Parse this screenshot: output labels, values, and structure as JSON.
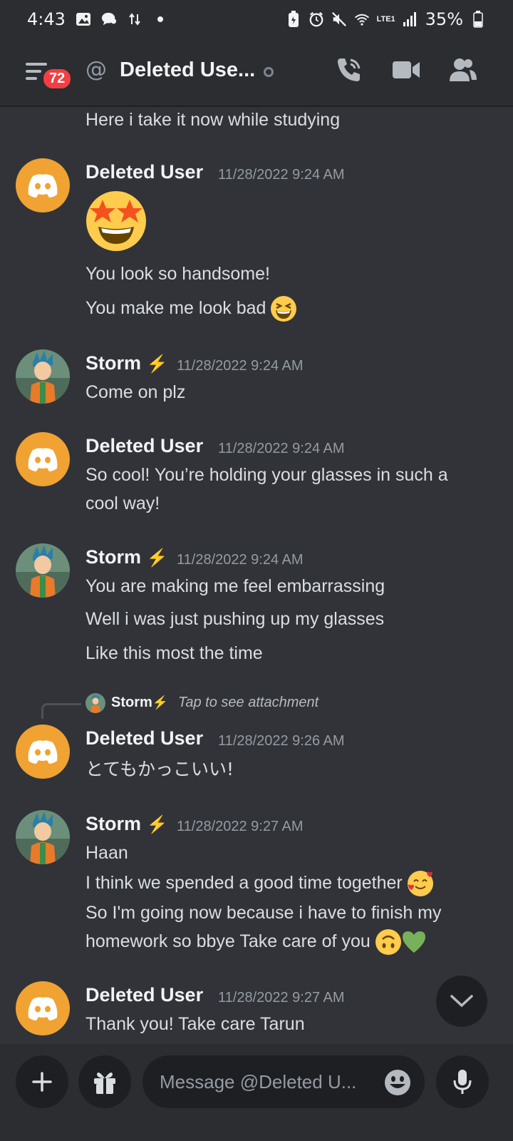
{
  "status_bar": {
    "time": "4:43",
    "battery": "35%",
    "lte": "LTE1"
  },
  "header": {
    "notification_count": "72",
    "title": "Deleted Use...",
    "at_symbol": "@"
  },
  "messages": {
    "first_line": "Here i take it now while studying",
    "m1": {
      "author": "Deleted User",
      "time": "11/28/2022 9:24 AM",
      "line1": "You look so handsome!",
      "line2": "You make me look bad"
    },
    "m2": {
      "author": "Storm",
      "time": "11/28/2022 9:24 AM",
      "line1": "Come on plz"
    },
    "m3": {
      "author": "Deleted User",
      "time": "11/28/2022 9:24 AM",
      "line1": "So cool! You’re holding your glasses in such a",
      "line2": "cool way!"
    },
    "m4": {
      "author": "Storm",
      "time": "11/28/2022 9:24 AM",
      "line1": "You are making me feel embarrassing",
      "line2": "Well i was just pushing up my glasses",
      "line3": "Like this most the time"
    },
    "reply": {
      "name": "Storm",
      "text": "Tap to see attachment"
    },
    "m5": {
      "author": "Deleted User",
      "time": "11/28/2022 9:26 AM",
      "line1": "とてもかっこいい!"
    },
    "m6": {
      "author": "Storm",
      "time": "11/28/2022 9:27 AM",
      "line1": "Haan",
      "line2": "I think we spended a good time together",
      "line3": "So I'm going now because i have to finish my",
      "line4": "homework so bbye Take care of you"
    },
    "m7": {
      "author": "Deleted User",
      "time": "11/28/2022 9:27 AM",
      "line1": "Thank you! Take care Tarun"
    }
  },
  "composer": {
    "placeholder": "Message @Deleted U..."
  },
  "colors": {
    "background": "#313338",
    "header": "#2b2d31",
    "discord_avatar": "#f0a232",
    "badge": "#f23f43"
  },
  "icons": [
    "menu-icon",
    "phone-icon",
    "video-icon",
    "members-icon",
    "plus-icon",
    "gift-icon",
    "emoji-icon",
    "mic-icon",
    "chevron-down-icon"
  ]
}
